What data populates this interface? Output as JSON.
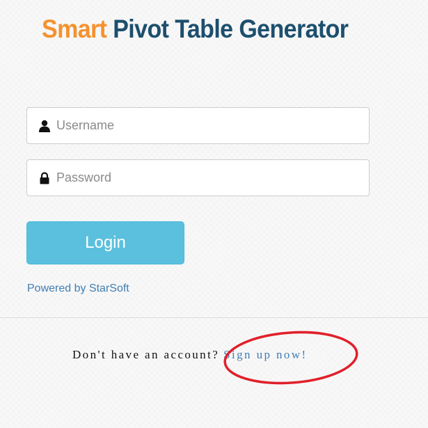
{
  "header": {
    "title_part1": "Smart",
    "title_part2": "Pivot Table Generator",
    "colors": {
      "title_part1": "#f5922f",
      "title_part2": "#1d4f6e"
    }
  },
  "form": {
    "username": {
      "placeholder": "Username",
      "value": "",
      "icon": "user-icon"
    },
    "password": {
      "placeholder": "Password",
      "value": "",
      "icon": "lock-icon"
    },
    "login_label": "Login",
    "login_color": "#5bc0de"
  },
  "footer": {
    "powered_by": "Powered by StarSoft",
    "signup_prompt": "Don't have an account?",
    "signup_link": "Sign up now!",
    "link_color": "#3f7eb3"
  },
  "annotation": {
    "type": "red-ellipse-highlight",
    "color": "#e0202a"
  }
}
